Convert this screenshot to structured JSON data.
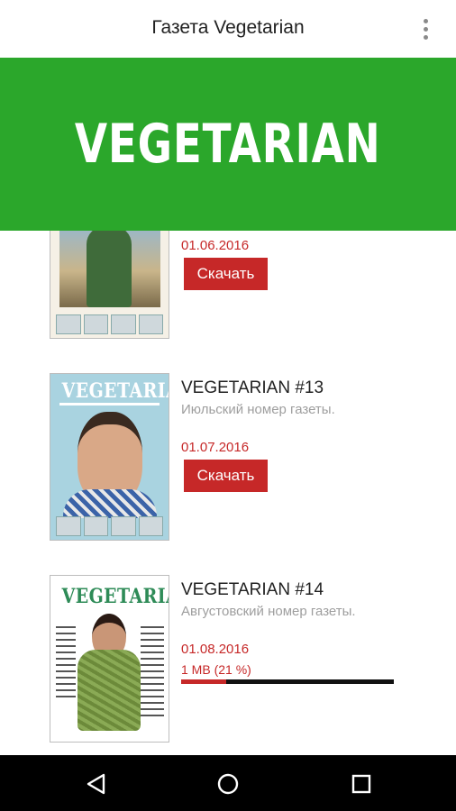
{
  "appbar": {
    "title": "Газета Vegetarian",
    "menu_icon": "more-vert-icon"
  },
  "banner": {
    "text": "VEGETARIAN",
    "color": "#2ba72b"
  },
  "colors": {
    "accent": "#c62828",
    "banner": "#2ba72b"
  },
  "items": [
    {
      "title": "",
      "description": "",
      "date": "01.06.2016",
      "download_label": "Скачать"
    },
    {
      "title": "VEGETARIAN #13",
      "description": "Июльский номер газеты.",
      "date": "01.07.2016",
      "download_label": "Скачать",
      "cover_heading": "VEGETARIAN"
    },
    {
      "title": "VEGETARIAN #14",
      "description": "Августовский номер газеты.",
      "date": "01.08.2016",
      "progress_text": "1 MB (21 %)",
      "progress": 0.21,
      "cover_heading": "VEGETARIAN"
    }
  ],
  "navbar": {
    "icons": [
      "back-icon",
      "home-icon",
      "recents-icon"
    ]
  }
}
